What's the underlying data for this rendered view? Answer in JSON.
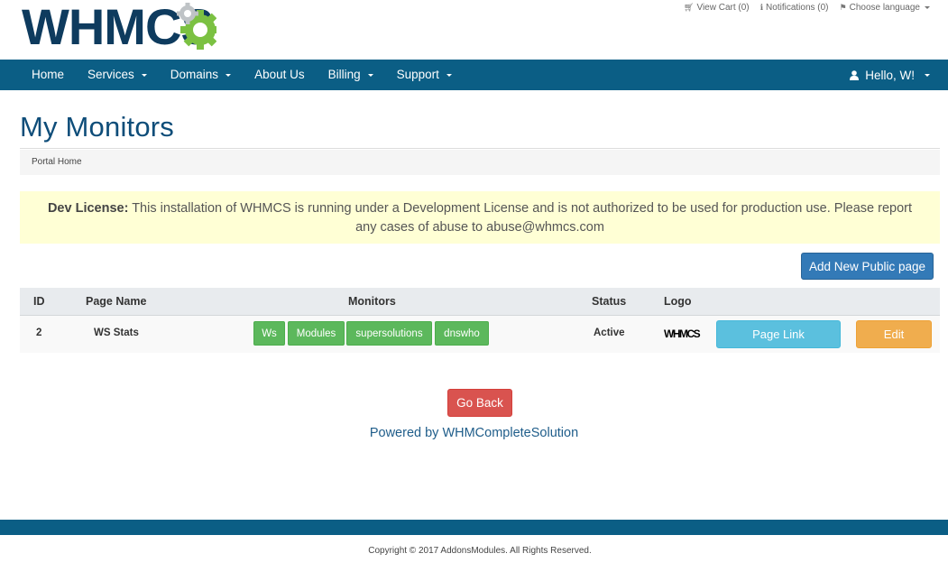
{
  "brand": {
    "logo_text": "WHMCS"
  },
  "top_links": [
    {
      "icon": "cart-icon",
      "label": "View Cart (0)"
    },
    {
      "icon": "info-icon",
      "label": "Notifications (0)"
    },
    {
      "icon": "language-icon",
      "label": "Choose language"
    }
  ],
  "nav": {
    "items": [
      {
        "label": "Home",
        "dropdown": false
      },
      {
        "label": "Services",
        "dropdown": true
      },
      {
        "label": "Domains",
        "dropdown": true
      },
      {
        "label": "About Us",
        "dropdown": false
      },
      {
        "label": "Billing",
        "dropdown": true
      },
      {
        "label": "Support",
        "dropdown": true
      }
    ],
    "user_label": "Hello, W!"
  },
  "page": {
    "title": "My Monitors",
    "breadcrumb": "Portal Home"
  },
  "alert": {
    "strong": "Dev License:",
    "text": " This installation of WHMCS is running under a Development License and is not authorized to be used for production use. Please report any cases of abuse to abuse@whmcs.com"
  },
  "actions": {
    "add_label": "Add New Public page"
  },
  "table": {
    "headers": {
      "id": "ID",
      "page_name": "Page Name",
      "monitors": "Monitors",
      "status": "Status",
      "logo": "Logo"
    },
    "rows": [
      {
        "id": "2",
        "page_name": "WS Stats",
        "monitors": [
          "Ws",
          "Modules",
          "supersolutions",
          "dnswho"
        ],
        "status": "Active",
        "logo_text": "WHMCS",
        "link_label": "Page Link",
        "edit_label": "Edit"
      }
    ]
  },
  "back_label": "Go Back",
  "powered_by": "Powered by WHMCompleteSolution",
  "copyright": "Copyright © 2017 AddonsModules. All Rights Reserved.",
  "colors": {
    "navbar": "#0b5e85",
    "primary": "#337ab7",
    "success": "#5cb85c",
    "info": "#5bc0de",
    "warning": "#f0ad4e",
    "danger": "#d9534f",
    "alert_bg": "#ffffd5"
  }
}
